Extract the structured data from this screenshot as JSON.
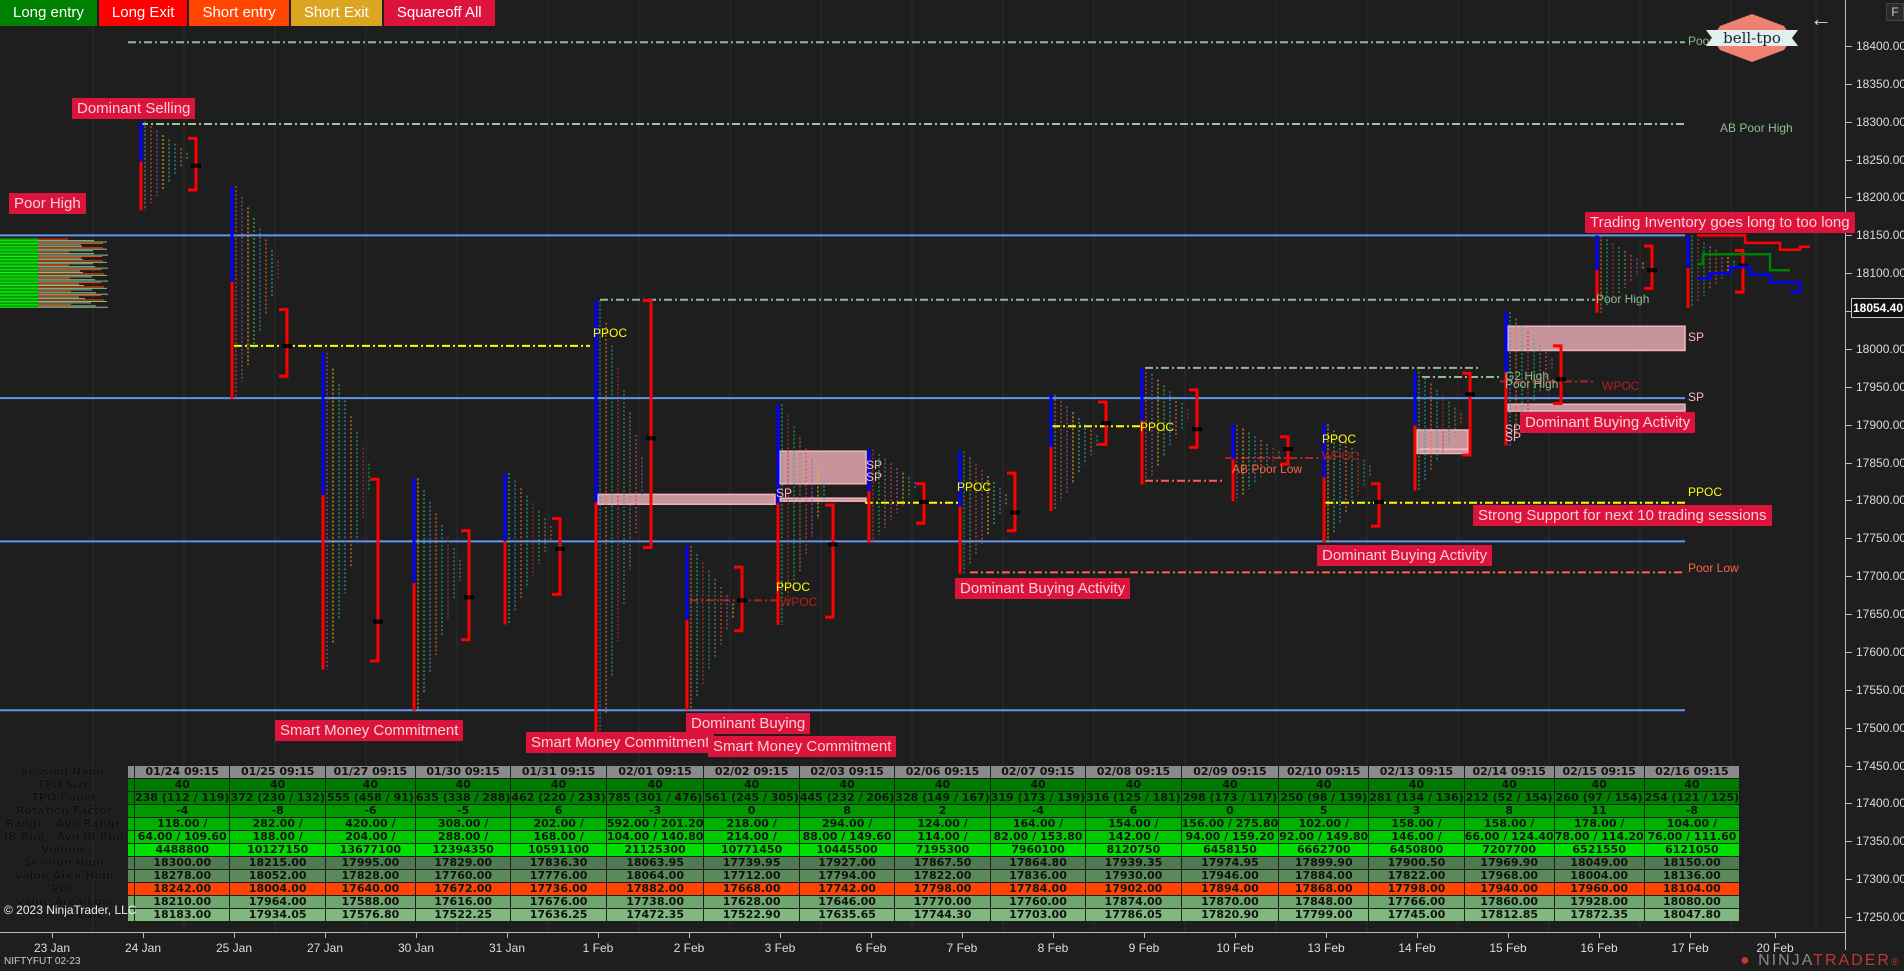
{
  "toolbar": {
    "buttons": [
      {
        "label": "Long entry",
        "color": "#008000"
      },
      {
        "label": "Long Exit",
        "color": "#ff0000"
      },
      {
        "label": "Short entry",
        "color": "#ff4500"
      },
      {
        "label": "Short Exit",
        "color": "#daa520"
      },
      {
        "label": "Squareoff All",
        "color": "#dc143c"
      }
    ]
  },
  "top_right": {
    "logo_text": "bell-tpo",
    "back_icon": "arrow-left-icon",
    "f_button": "F"
  },
  "instrument": "NIFTYFUT 02-23",
  "copyright": "© 2023 NinjaTrader, LLC",
  "brand": {
    "ninja": "NINJA",
    "trader": "TRADER",
    "suffix": "®"
  },
  "last_price": "18054.40",
  "colors": {
    "background": "#1e1e1e",
    "annotation_bg": "#dc143c",
    "blue_level": "#6495ed",
    "ppoc": "#ffff00",
    "wpoc": "#b22222",
    "poor": "#ff6347",
    "poor_high": "#8fbc8f",
    "single_print": "#ffb6c1",
    "poc_row": "#ff4500"
  },
  "chart_data": {
    "type": "tpo-profile",
    "y_axis": {
      "min": 17225,
      "max": 18425,
      "ticks": [
        18400,
        18350,
        18300,
        18250,
        18200,
        18150,
        18100,
        18050,
        18000,
        17950,
        17900,
        17850,
        17800,
        17750,
        17700,
        17650,
        17600,
        17550,
        17500,
        17450,
        17400,
        17350,
        17300,
        17250
      ]
    },
    "x_axis": {
      "labels": [
        "23 Jan",
        "24 Jan",
        "25 Jan",
        "27 Jan",
        "30 Jan",
        "31 Jan",
        "1 Feb",
        "2 Feb",
        "3 Feb",
        "6 Feb",
        "7 Feb",
        "8 Feb",
        "9 Feb",
        "10 Feb",
        "13 Feb",
        "14 Feb",
        "15 Feb",
        "16 Feb",
        "17 Feb",
        "20 Feb"
      ]
    },
    "horizontal_levels": [
      {
        "price": 18150,
        "kind": "blue"
      },
      {
        "price": 17935,
        "kind": "blue"
      },
      {
        "price": 17746,
        "kind": "blue"
      },
      {
        "price": 17523,
        "kind": "blue"
      }
    ],
    "sessions": [
      {
        "date": "24 Jan",
        "high": 18300,
        "low": 18183,
        "poc": 18242,
        "vah": 18278,
        "val": 18210
      },
      {
        "date": "25 Jan",
        "high": 18215,
        "low": 17934.05,
        "poc": 18004,
        "vah": 18052,
        "val": 17964
      },
      {
        "date": "27 Jan",
        "high": 17995,
        "low": 17576.8,
        "poc": 17640,
        "vah": 17828,
        "val": 17588
      },
      {
        "date": "30 Jan",
        "high": 17829,
        "low": 17522.25,
        "poc": 17672,
        "vah": 17760,
        "val": 17616
      },
      {
        "date": "31 Jan",
        "high": 17836.3,
        "low": 17636.25,
        "poc": 17736,
        "vah": 17776,
        "val": 17676
      },
      {
        "date": "1 Feb",
        "high": 18063.95,
        "low": 17472.35,
        "poc": 17882,
        "vah": 18064,
        "val": 17738
      },
      {
        "date": "2 Feb",
        "high": 17739.95,
        "low": 17522.9,
        "poc": 17668,
        "vah": 17712,
        "val": 17628
      },
      {
        "date": "3 Feb",
        "high": 17927,
        "low": 17635.65,
        "poc": 17742,
        "vah": 17794,
        "val": 17646
      },
      {
        "date": "6 Feb",
        "high": 17867.5,
        "low": 17744.3,
        "poc": 17798,
        "vah": 17822,
        "val": 17770
      },
      {
        "date": "7 Feb",
        "high": 17864.8,
        "low": 17703,
        "poc": 17784,
        "vah": 17836,
        "val": 17760
      },
      {
        "date": "8 Feb",
        "high": 17939.35,
        "low": 17786.05,
        "poc": 17902,
        "vah": 17930,
        "val": 17874
      },
      {
        "date": "9 Feb",
        "high": 17974.95,
        "low": 17820.9,
        "poc": 17894,
        "vah": 17946,
        "val": 17870
      },
      {
        "date": "10 Feb",
        "high": 17899.9,
        "low": 17799,
        "poc": 17868,
        "vah": 17884,
        "val": 17848
      },
      {
        "date": "13 Feb",
        "high": 17900.5,
        "low": 17745,
        "poc": 17798,
        "vah": 17822,
        "val": 17766
      },
      {
        "date": "14 Feb",
        "high": 17969.9,
        "low": 17812.85,
        "poc": 17940,
        "vah": 17968,
        "val": 17860
      },
      {
        "date": "15 Feb",
        "high": 18049,
        "low": 17872.35,
        "poc": 17960,
        "vah": 18004,
        "val": 17928
      },
      {
        "date": "16 Feb",
        "high": 18150,
        "low": 18047.8,
        "poc": 18104,
        "vah": 18136,
        "val": 18080
      },
      {
        "date": "17 Feb",
        "high": 18150,
        "low": 18054.4,
        "poc": 18110,
        "vah": 18130,
        "val": 18075
      }
    ],
    "level_labels": [
      {
        "text": "Poor High",
        "price": 18405,
        "color": "#8fbc8f"
      },
      {
        "text": "AB Poor High",
        "price": 18290,
        "color": "#8fbc8f"
      },
      {
        "text": "Poor High",
        "price": 18065,
        "color": "#8fbc8f"
      },
      {
        "text": "SP",
        "price": 18015,
        "color": "#ffb6c1"
      },
      {
        "text": "SP",
        "price": 17935,
        "color": "#ffb6c1"
      },
      {
        "text": "WPOC",
        "price": 17950,
        "color": "#b22222"
      },
      {
        "text": "PPOC",
        "price": 17810,
        "color": "#ffff00"
      },
      {
        "text": "Poor Low",
        "price": 17710,
        "color": "#ff6347"
      },
      {
        "text": "PPOC",
        "price": 18020,
        "color": "#ffff00"
      },
      {
        "text": "PPOC",
        "price": 17895,
        "color": "#ffff00"
      },
      {
        "text": "PPOC",
        "price": 17817,
        "color": "#ffff00"
      },
      {
        "text": "PPOC",
        "price": 17685,
        "color": "#ffff00"
      },
      {
        "text": "WPOC",
        "price": 17665,
        "color": "#b22222"
      },
      {
        "text": "PPOC",
        "price": 17880,
        "color": "#ffff00"
      },
      {
        "text": "WPOC",
        "price": 17858,
        "color": "#b22222"
      },
      {
        "text": "AB Poor Low",
        "price": 17840,
        "color": "#ff6347"
      },
      {
        "text": "G2 High",
        "price": 17963,
        "color": "#8fbc8f"
      },
      {
        "text": "Poor High",
        "price": 17952,
        "color": "#8fbc8f"
      },
      {
        "text": "SP",
        "price": 17845,
        "color": "#ffb6c1"
      },
      {
        "text": "SP",
        "price": 17830,
        "color": "#ffb6c1"
      },
      {
        "text": "SP",
        "price": 17808,
        "color": "#ffb6c1"
      },
      {
        "text": "SP",
        "price": 17893,
        "color": "#ffb6c1"
      },
      {
        "text": "SP",
        "price": 17883,
        "color": "#ffb6c1"
      }
    ],
    "annotations": [
      "Dominant Selling",
      "Poor High",
      "Trading Inventory goes long to too long",
      "Dominant Buying Activity",
      "Strong Support for next 10 trading sessions",
      "Dominant Buying Activity",
      "Dominant Buying Activity",
      "Smart Money Commitment",
      "Smart Money Commitment",
      "Dominant Buying",
      "Smart Money Commitment"
    ]
  },
  "stats_table": {
    "row_labels": [
      "Session Name",
      "TPO Size",
      "TPO Count",
      "Rotation Factor",
      "Range / Avg Range",
      "IB Rng / Avg IB Rng",
      "Volume",
      "Session High",
      "Value Area High",
      "POC",
      "Value Area Low",
      "Session Low"
    ],
    "row_colors": [
      "#8a8a8a",
      "#007a00",
      "#008000",
      "#009a00",
      "#00b000",
      "#00c800",
      "#00e000",
      "#4f7a4f",
      "#5a8a5a",
      "#ff4500",
      "#6fa56f",
      "#80b880"
    ],
    "columns": [
      {
        "session": "01/24 09:15",
        "tpo_size": "40",
        "tpo_count": "238 (112 / 119)",
        "rotation": "-4",
        "range": "118.00 /",
        "ib": "64.00 / 109.60",
        "volume": "4488800",
        "high": "18300.00",
        "vah": "18278.00",
        "poc": "18242.00",
        "val": "18210.00",
        "low": "18183.00"
      },
      {
        "session": "01/25 09:15",
        "tpo_size": "40",
        "tpo_count": "372 (230 / 132)",
        "rotation": "-8",
        "range": "282.00 /",
        "ib": "188.00 /",
        "volume": "10127150",
        "high": "18215.00",
        "vah": "18052.00",
        "poc": "18004.00",
        "val": "17964.00",
        "low": "17934.05"
      },
      {
        "session": "01/27 09:15",
        "tpo_size": "40",
        "tpo_count": "555 (458 / 91)",
        "rotation": "-6",
        "range": "420.00 /",
        "ib": "204.00 /",
        "volume": "13677100",
        "high": "17995.00",
        "vah": "17828.00",
        "poc": "17640.00",
        "val": "17588.00",
        "low": "17576.80"
      },
      {
        "session": "01/30 09:15",
        "tpo_size": "40",
        "tpo_count": "635 (338 / 288)",
        "rotation": "-5",
        "range": "308.00 /",
        "ib": "288.00 /",
        "volume": "12394350",
        "high": "17829.00",
        "vah": "17760.00",
        "poc": "17672.00",
        "val": "17616.00",
        "low": "17522.25"
      },
      {
        "session": "01/31 09:15",
        "tpo_size": "40",
        "tpo_count": "462 (220 / 233)",
        "rotation": "6",
        "range": "202.00 /",
        "ib": "168.00 /",
        "volume": "10591100",
        "high": "17836.30",
        "vah": "17776.00",
        "poc": "17736.00",
        "val": "17676.00",
        "low": "17636.25"
      },
      {
        "session": "02/01 09:15",
        "tpo_size": "40",
        "tpo_count": "785 (301 / 476)",
        "rotation": "-3",
        "range": "592.00 / 201.20",
        "ib": "104.00 / 140.80",
        "volume": "21125300",
        "high": "18063.95",
        "vah": "18064.00",
        "poc": "17882.00",
        "val": "17738.00",
        "low": "17472.35"
      },
      {
        "session": "02/02 09:15",
        "tpo_size": "40",
        "tpo_count": "561 (245 / 305)",
        "rotation": "0",
        "range": "218.00 /",
        "ib": "214.00 /",
        "volume": "10771450",
        "high": "17739.95",
        "vah": "17712.00",
        "poc": "17668.00",
        "val": "17628.00",
        "low": "17522.90"
      },
      {
        "session": "02/03 09:15",
        "tpo_size": "40",
        "tpo_count": "445 (232 / 206)",
        "rotation": "8",
        "range": "294.00 /",
        "ib": "88.00 / 149.60",
        "volume": "10445500",
        "high": "17927.00",
        "vah": "17794.00",
        "poc": "17742.00",
        "val": "17646.00",
        "low": "17635.65"
      },
      {
        "session": "02/06 09:15",
        "tpo_size": "40",
        "tpo_count": "328 (149 / 167)",
        "rotation": "2",
        "range": "124.00 /",
        "ib": "114.00 /",
        "volume": "7195300",
        "high": "17867.50",
        "vah": "17822.00",
        "poc": "17798.00",
        "val": "17770.00",
        "low": "17744.30"
      },
      {
        "session": "02/07 09:15",
        "tpo_size": "40",
        "tpo_count": "319 (173 / 139)",
        "rotation": "-4",
        "range": "164.00 /",
        "ib": "82.00 / 153.80",
        "volume": "7960100",
        "high": "17864.80",
        "vah": "17836.00",
        "poc": "17784.00",
        "val": "17760.00",
        "low": "17703.00"
      },
      {
        "session": "02/08 09:15",
        "tpo_size": "40",
        "tpo_count": "316 (125 / 181)",
        "rotation": "6",
        "range": "154.00 /",
        "ib": "142.00 /",
        "volume": "8120750",
        "high": "17939.35",
        "vah": "17930.00",
        "poc": "17902.00",
        "val": "17874.00",
        "low": "17786.05"
      },
      {
        "session": "02/09 09:15",
        "tpo_size": "40",
        "tpo_count": "298 (173 / 117)",
        "rotation": "0",
        "range": "156.00 / 275.80",
        "ib": "94.00 / 159.20",
        "volume": "6458150",
        "high": "17974.95",
        "vah": "17946.00",
        "poc": "17894.00",
        "val": "17870.00",
        "low": "17820.90"
      },
      {
        "session": "02/10 09:15",
        "tpo_size": "40",
        "tpo_count": "250 (98 / 139)",
        "rotation": "5",
        "range": "102.00 /",
        "ib": "92.00 / 149.80",
        "volume": "6662700",
        "high": "17899.90",
        "vah": "17884.00",
        "poc": "17868.00",
        "val": "17848.00",
        "low": "17799.00"
      },
      {
        "session": "02/13 09:15",
        "tpo_size": "40",
        "tpo_count": "281 (134 / 136)",
        "rotation": "3",
        "range": "158.00 /",
        "ib": "146.00 /",
        "volume": "6450800",
        "high": "17900.50",
        "vah": "17822.00",
        "poc": "17798.00",
        "val": "17766.00",
        "low": "17745.00"
      },
      {
        "session": "02/14 09:15",
        "tpo_size": "40",
        "tpo_count": "212 (52 / 154)",
        "rotation": "8",
        "range": "158.00 /",
        "ib": "66.00 / 124.40",
        "volume": "7207700",
        "high": "17969.90",
        "vah": "17968.00",
        "poc": "17940.00",
        "val": "17860.00",
        "low": "17812.85"
      },
      {
        "session": "02/15 09:15",
        "tpo_size": "40",
        "tpo_count": "260 (97 / 154)",
        "rotation": "11",
        "range": "178.00 /",
        "ib": "78.00 / 114.20",
        "volume": "6521550",
        "high": "18049.00",
        "vah": "18004.00",
        "poc": "17960.00",
        "val": "17928.00",
        "low": "17872.35"
      },
      {
        "session": "02/16 09:15",
        "tpo_size": "40",
        "tpo_count": "254 (121 / 125)",
        "rotation": "-8",
        "range": "104.00 /",
        "ib": "76.00 / 111.60",
        "volume": "6121050",
        "high": "18150.00",
        "vah": "18136.00",
        "poc": "18104.00",
        "val": "18080.00",
        "low": "18047.80"
      }
    ]
  }
}
